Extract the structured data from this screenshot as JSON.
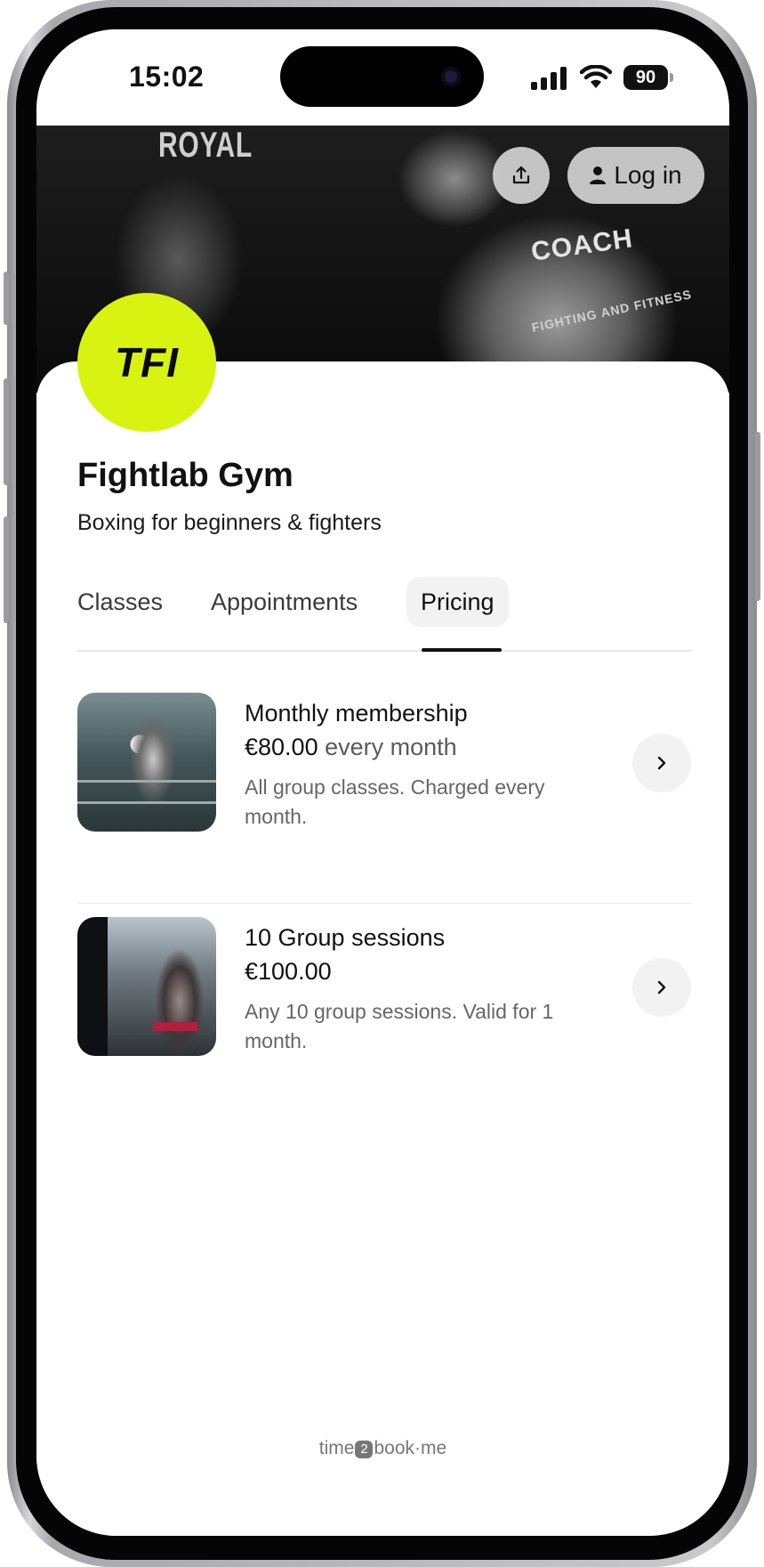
{
  "status_bar": {
    "time": "15:02",
    "battery": "90"
  },
  "hero": {
    "coach_text": "COACH",
    "fitness_text": "FIGHTING AND FITNESS",
    "bag_text": "ROYAL"
  },
  "header_actions": {
    "share_icon": "share-icon",
    "login_label": "Log in",
    "login_icon": "user-icon"
  },
  "gym": {
    "logo_text": "TFI",
    "logo_color": "#d8f30f",
    "name": "Fightlab Gym",
    "tagline": "Boxing for beginners & fighters"
  },
  "tabs": [
    {
      "label": "Classes",
      "active": false
    },
    {
      "label": "Appointments",
      "active": false
    },
    {
      "label": "Pricing",
      "active": true
    }
  ],
  "pricing": [
    {
      "title": "Monthly membership",
      "price": "€80.00",
      "period": "every month",
      "description": "All group classes. Charged every month."
    },
    {
      "title": "10 Group sessions",
      "price": "€100.00",
      "period": "",
      "description": "Any 10 group sessions. Valid for 1 month."
    }
  ],
  "footer": {
    "brand_left": "time",
    "brand_badge": "2",
    "brand_right": "book·me"
  }
}
